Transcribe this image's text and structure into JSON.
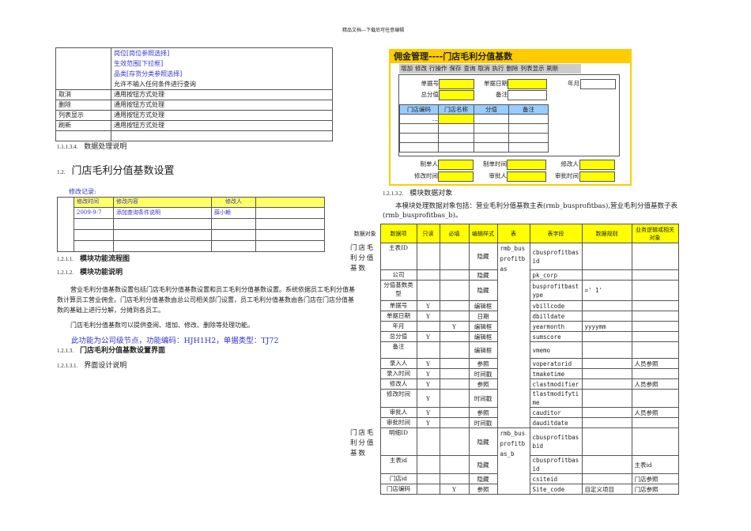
{
  "page_header": "精品文档---下载后可任意编辑",
  "top_table": {
    "first_row_lines": [
      {
        "text": "岗位[岗位参照选择]",
        "blue": true
      },
      {
        "text": "生效范围[下拉框]",
        "blue": true
      },
      {
        "text": "品类[存货分类参照选择]",
        "blue": true
      },
      {
        "text": "允许不输入任何条件进行查询",
        "blue": false
      }
    ],
    "rows": [
      {
        "name": "取消",
        "desc": "通用按钮方式处理"
      },
      {
        "name": "删除",
        "desc": "通用按钮方式处理"
      },
      {
        "name": "列表显示",
        "desc": "通用按钮方式处理"
      },
      {
        "name": "刷新",
        "desc": "通用按钮方式处理"
      },
      {
        "name": "",
        "desc": ""
      }
    ]
  },
  "sections": {
    "s1113_4": {
      "num": "1.1.1.3.4.",
      "title": "数据处理说明"
    },
    "s12": {
      "num": "1.2.",
      "title": "门店毛利分值基数设置"
    },
    "s1211": {
      "num": "1.2.1.1.",
      "title": "模块功能流程图"
    },
    "s1212": {
      "num": "1.2.1.2.",
      "title": "模块功能说明"
    },
    "s1213": {
      "num": "1.2.1.3.",
      "title": "门店毛利分值基数设置界面"
    },
    "s12131": {
      "num": "1.2.1.3.1.",
      "title": "界面设计说明"
    },
    "s12132": {
      "num": "1.2.1.3.2.",
      "title": "模块数据对象"
    }
  },
  "revision": {
    "label": "修改记录:",
    "headers": [
      "修改时间",
      "修改内容",
      "修改人",
      ""
    ],
    "rows": [
      [
        "2009-9-7",
        "添加查询条件说明",
        "薛小赖",
        ""
      ],
      [
        "",
        "",
        "",
        ""
      ],
      [
        "",
        "",
        "",
        ""
      ],
      [
        "",
        "",
        "",
        ""
      ]
    ]
  },
  "body": {
    "para1": [
      "营业毛利分值基数设置包括门店毛利分值基数设置和员工毛利分值基数设置。系统依据员工毛利分值基",
      "数计算员工营业佣金。门店毛利分值基数由总公司相关部门设置，员工毛利分值基数由各门店在门店分值基",
      "数的基础上进行分解，分摊到各员工。"
    ],
    "para2": "门店毛利分值基数可以提供查阅、增加、修改、删除等处理功能。",
    "node_info": "此功能为公司级节点，功能编码：HJH1H2，单据类型：TJ72",
    "data_objects_intro": [
      "本模块处理数据对象包括：营业毛利分值基数主表(rmb_busprofitbas),营业毛利分值基数子表",
      "(rmb_busprofitbas_b)。"
    ]
  },
  "form": {
    "title": "佣金管理----门店毛利分值基数",
    "toolbar": [
      "增加",
      "修改",
      "行操作",
      "保存",
      "查询",
      "取消",
      "执行",
      "删除",
      "列表显示",
      "刷新"
    ],
    "labels": {
      "bill_no": "单据号",
      "bill_date": "单据日期",
      "year_month": "年月",
      "total": "总分值",
      "note": "备注",
      "maker": "制单人",
      "make_time": "制单时间",
      "modifier": "修改人",
      "modify_time": "修改时间",
      "approver": "审批人",
      "approve_time": "审批时间"
    },
    "grid_headers": [
      "门店编码",
      "门店名称",
      "分值",
      "备注"
    ],
    "grid_first_cell": "...",
    "colors": {
      "title_bar": "#ffcc00",
      "required": "#ffff00",
      "grid_header": "#99ccff"
    }
  },
  "data_table": {
    "headers": [
      "数据对象",
      "数据项",
      "只读",
      "必填",
      "编辑样式",
      "表",
      "表字段",
      "数据规则",
      "业务逻辑或相关对象"
    ],
    "groups": [
      {
        "object": "门店毛利分值基数",
        "table": "rmb_busprofitbas",
        "rows": [
          [
            "主表ID",
            "",
            "",
            "隐藏",
            "cbusprofitbasid",
            "",
            ""
          ],
          [
            "公司",
            "",
            "",
            "隐藏",
            "pk_corp",
            "",
            ""
          ],
          [
            "分值基数类型",
            "",
            "",
            "隐藏",
            "busprofitbastype",
            "=' 1'",
            ""
          ],
          [
            "单据号",
            "Y",
            "",
            "编辑框",
            "vbillcode",
            "",
            ""
          ],
          [
            "单据日期",
            "Y",
            "",
            "日期",
            "dbilldate",
            "",
            ""
          ],
          [
            "年月",
            "",
            "Y",
            "编辑框",
            "yearmonth",
            "yyyymm",
            ""
          ],
          [
            "总分值",
            "Y",
            "",
            "编辑框",
            "sumscore",
            "",
            ""
          ],
          [
            "备注",
            "",
            "",
            "编辑框",
            "vmemo",
            "",
            ""
          ],
          [
            "录入人",
            "Y",
            "",
            "参照",
            "voperatorid",
            "",
            "人员参照"
          ],
          [
            "录入时间",
            "Y",
            "",
            "时间戳",
            "tmaketime",
            "",
            ""
          ],
          [
            "修改人",
            "Y",
            "",
            "参照",
            "clastmodifier",
            "",
            "人员参照"
          ],
          [
            "修改时间",
            "Y",
            "",
            "时间戳",
            "tlastmodifytime",
            "",
            ""
          ],
          [
            "审批人",
            "Y",
            "",
            "参照",
            "cauditor",
            "",
            "人员参照"
          ],
          [
            "审批时间",
            "Y",
            "",
            "时间戳",
            "dauditdate",
            "",
            ""
          ]
        ]
      },
      {
        "object": "门店毛利分值基数",
        "table": "rmb_busprofitbas_b",
        "rows": [
          [
            "明细ID",
            "",
            "",
            "隐藏",
            "cbusprofitbasbid",
            "",
            ""
          ],
          [
            "主表id",
            "",
            "",
            "隐藏",
            "cbusprofitbasid",
            "",
            "主表id"
          ],
          [
            "门店id",
            "",
            "",
            "隐藏",
            "csiteid",
            "",
            "门店参照"
          ],
          [
            "门店编码",
            "",
            "Y",
            "参照",
            "Site_code",
            "自定义项目",
            "门店参照"
          ]
        ]
      }
    ]
  }
}
